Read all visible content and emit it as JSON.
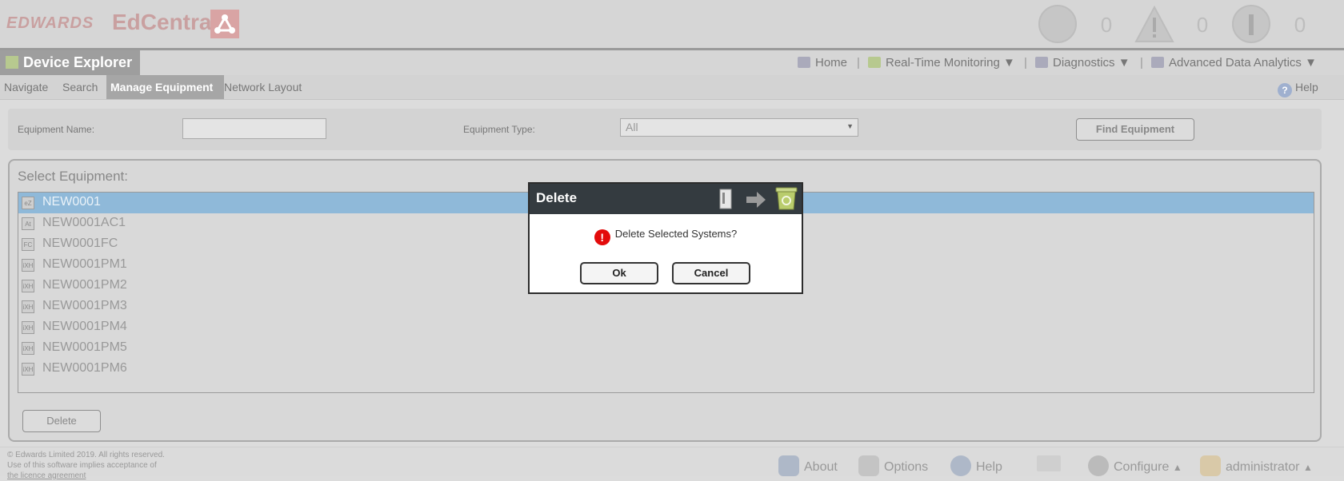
{
  "header": {
    "brand_company": "EDWARDS",
    "brand_product": "EdCentra",
    "counters": [
      {
        "icon": "alarm-icon",
        "value": "0"
      },
      {
        "icon": "warning-icon",
        "value": "0"
      },
      {
        "icon": "info-icon",
        "value": "0"
      }
    ]
  },
  "menubar": {
    "title": "Device Explorer",
    "home": "Home",
    "realtime": "Real-Time Monitoring",
    "diagnostics": "Diagnostics",
    "analytics": "Advanced Data Analytics",
    "separator": "|"
  },
  "tabs": {
    "navigate": "Navigate",
    "search": "Search",
    "manage": "Manage Equipment",
    "network": "Network Layout",
    "help": "Help"
  },
  "filter": {
    "name_label": "Equipment Name:",
    "name_value": "",
    "type_label": "Equipment Type:",
    "type_value": "All",
    "find_button": "Find Equipment"
  },
  "equipment": {
    "title": "Select Equipment:",
    "items": [
      {
        "icon": "eZ",
        "name": "NEW0001",
        "selected": true
      },
      {
        "icon": "At",
        "name": "NEW0001AC1"
      },
      {
        "icon": "FC",
        "name": "NEW0001FC"
      },
      {
        "icon": "iXH",
        "name": "NEW0001PM1"
      },
      {
        "icon": "iXH",
        "name": "NEW0001PM2"
      },
      {
        "icon": "iXH",
        "name": "NEW0001PM3"
      },
      {
        "icon": "iXH",
        "name": "NEW0001PM4"
      },
      {
        "icon": "iXH",
        "name": "NEW0001PM5"
      },
      {
        "icon": "iXH",
        "name": "NEW0001PM6"
      }
    ],
    "delete_button": "Delete"
  },
  "footer": {
    "copyright_1": "© Edwards Limited 2019. All rights reserved.",
    "copyright_2": "Use of this software implies acceptance of",
    "copyright_3": "the licence agreement",
    "about": "About",
    "options": "Options",
    "help": "Help",
    "configure": "Configure",
    "user": "administrator"
  },
  "dialog": {
    "title": "Delete",
    "message": "Delete Selected Systems?",
    "ok": "Ok",
    "cancel": "Cancel"
  }
}
